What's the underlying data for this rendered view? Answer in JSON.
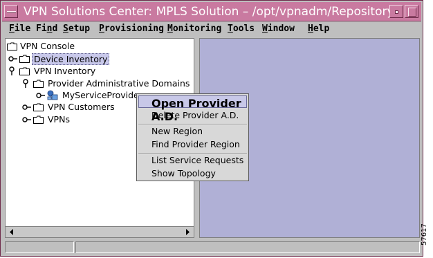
{
  "window": {
    "title": "VPN Solutions Center: MPLS Solution – /opt/vpnadm/Repository"
  },
  "menu_bar": {
    "items": [
      {
        "mnemonic": "F",
        "rest": "ile"
      },
      {
        "mnemonic": "",
        "pre": "Fi",
        "mid": "n",
        "rest": "d"
      },
      {
        "mnemonic": "S",
        "rest": "etup"
      },
      {
        "mnemonic": "P",
        "rest": "rovisioning"
      },
      {
        "mnemonic": "M",
        "rest": "onitoring"
      },
      {
        "mnemonic": "T",
        "rest": "ools"
      },
      {
        "mnemonic": "W",
        "rest": "indow"
      },
      {
        "mnemonic": "H",
        "rest": "elp"
      }
    ]
  },
  "tree": {
    "root": "VPN Console",
    "device_inventory": "Device Inventory",
    "vpn_inventory": "VPN Inventory",
    "provider_admin_domains": "Provider Administrative Domains",
    "my_service_provider": "MyServiceProvider",
    "vpn_customers": "VPN Customers",
    "vpns": "VPNs"
  },
  "context_menu": {
    "items": [
      "Open Provider A.D.",
      "Delete Provider A.D.",
      "New Region",
      "Find Provider Region",
      "List Service Requests",
      "Show Topology"
    ]
  },
  "side_label": "57617",
  "colors": {
    "title_bar": "#c97aa0",
    "workspace": "#b0b0d6",
    "chrome": "#bfbfbf"
  }
}
